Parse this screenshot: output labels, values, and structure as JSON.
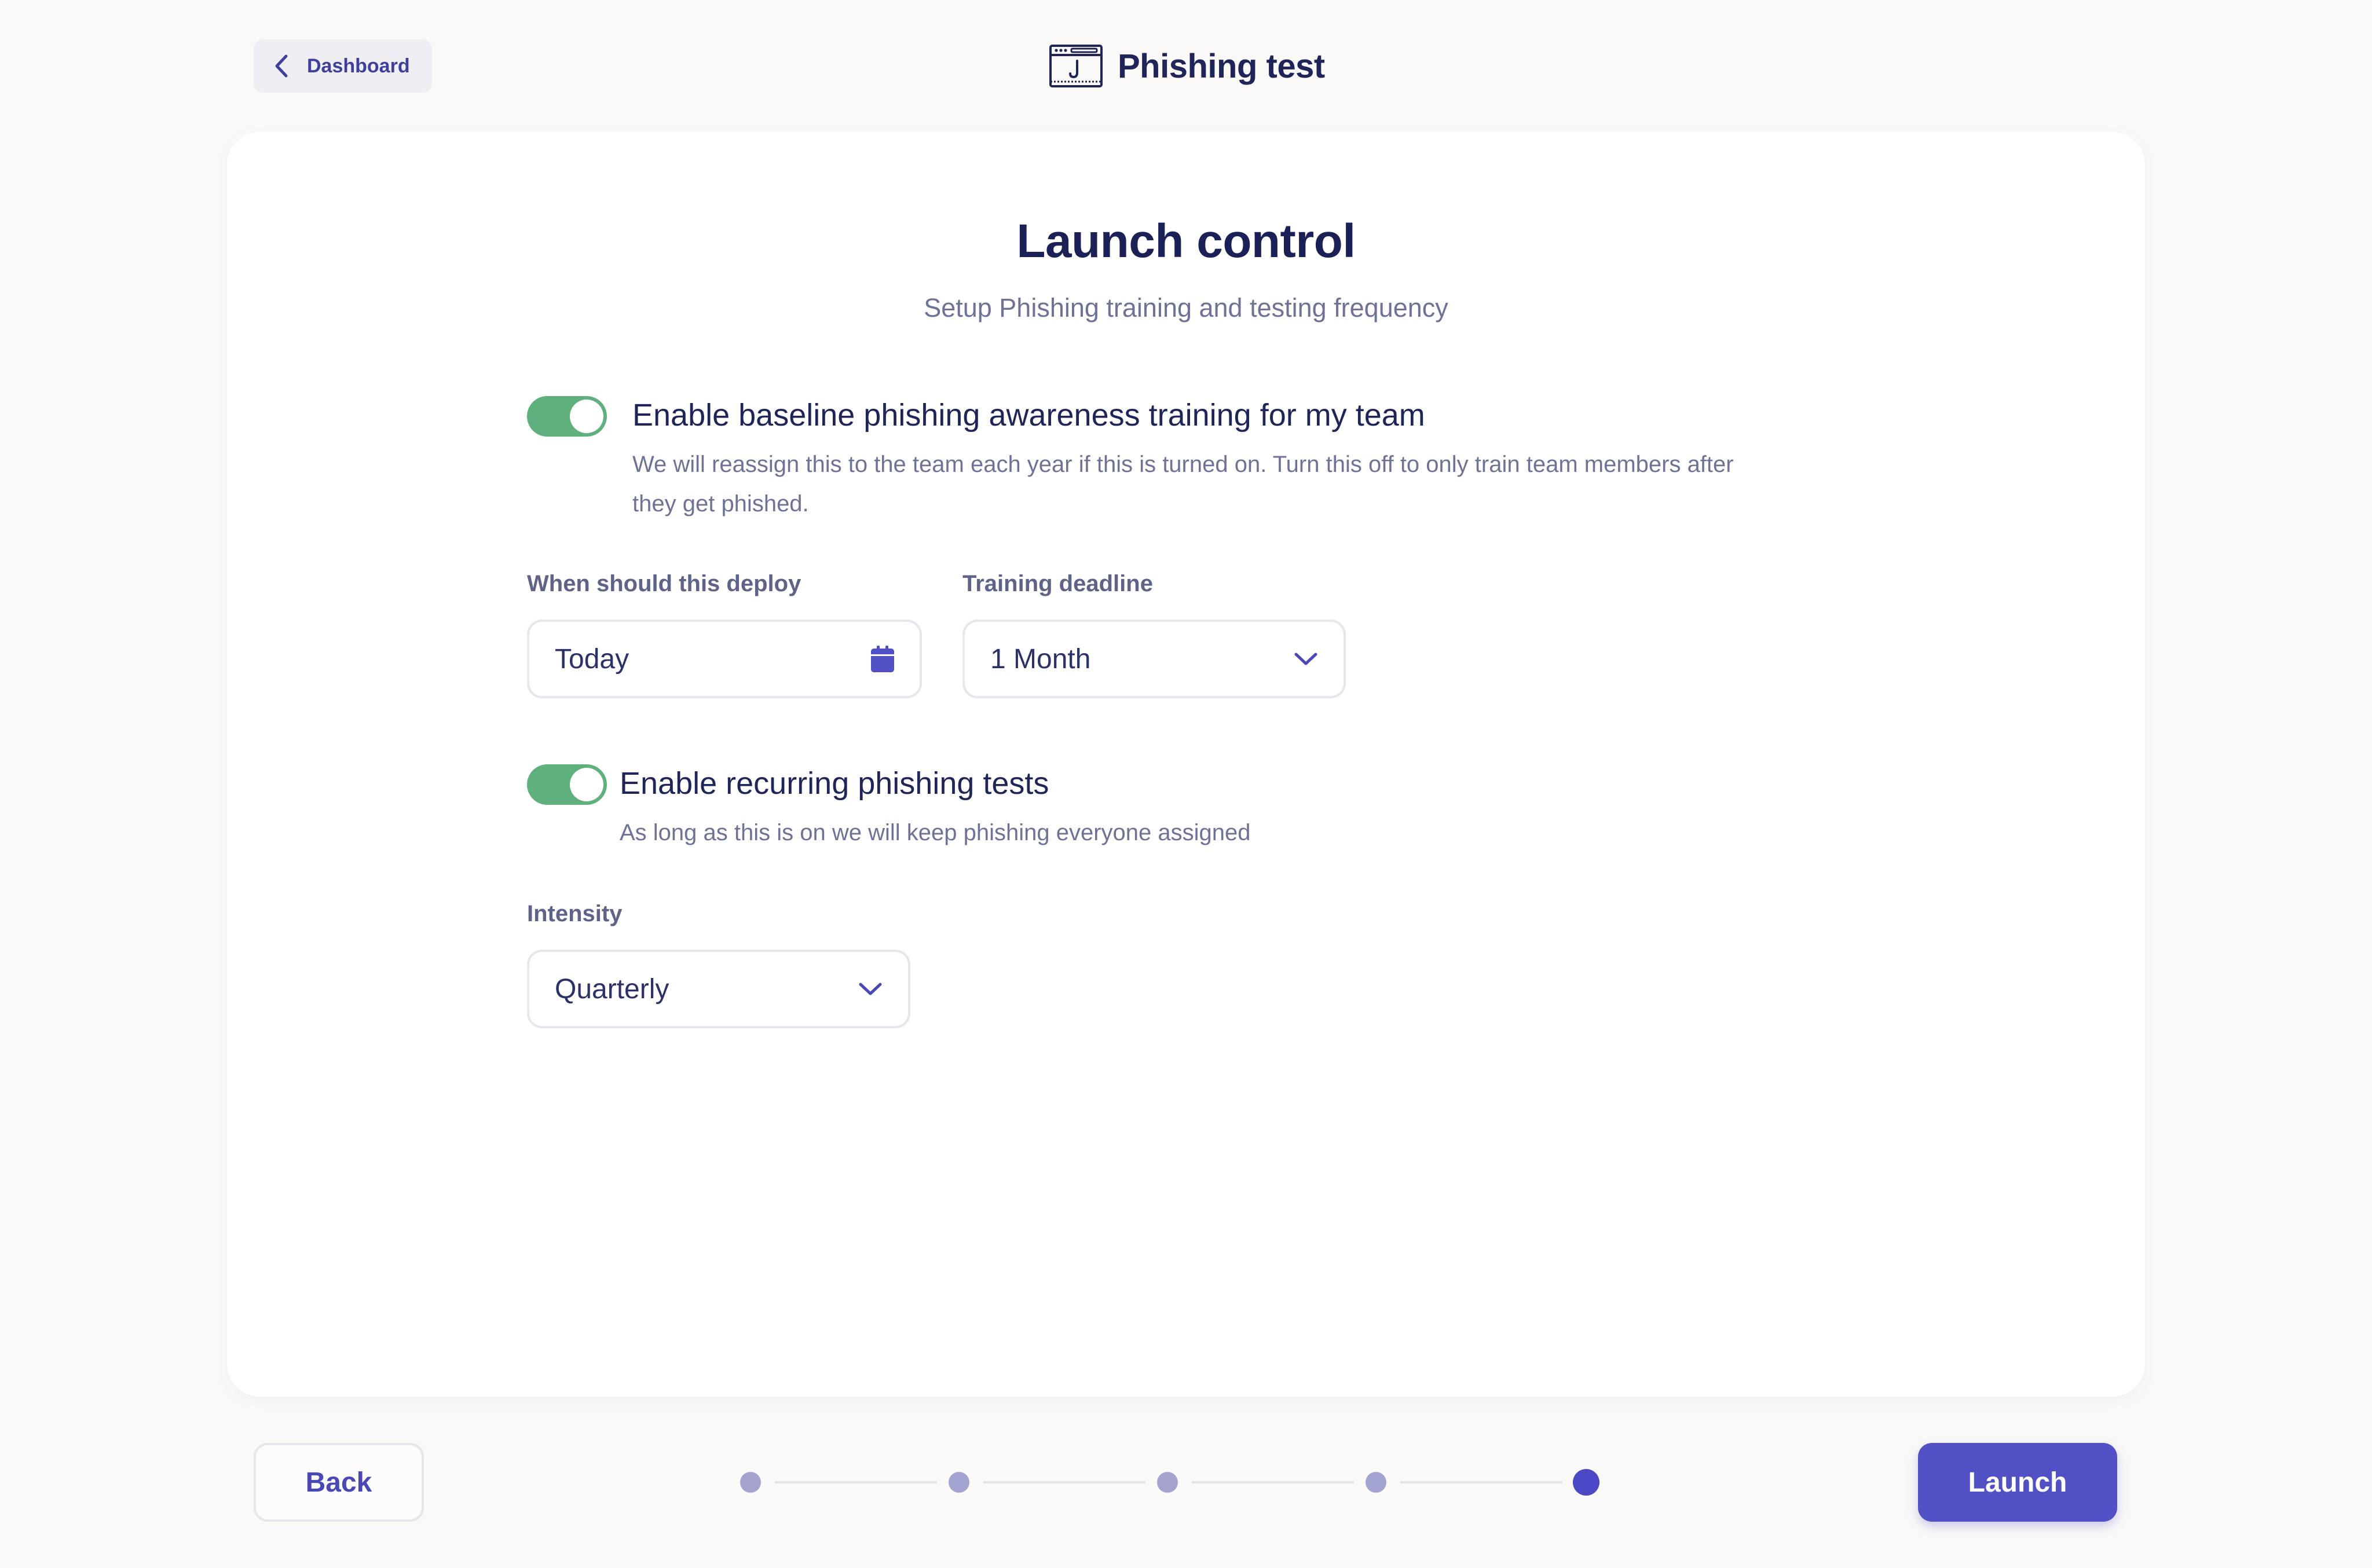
{
  "header": {
    "back_label": "Dashboard",
    "title": "Phishing test",
    "title_icon": "browser-hook-icon"
  },
  "card": {
    "heading": "Launch control",
    "subheading": "Setup Phishing training and testing frequency",
    "baseline": {
      "enabled": true,
      "title": "Enable baseline phishing awareness training for my team",
      "desc_line1": "We will reassign this to the team each year if this is turned on. Turn this off to only train team members after",
      "desc_line2": "they get phished."
    },
    "deploy": {
      "label": "When should this deploy",
      "value": "Today",
      "icon": "calendar-icon"
    },
    "deadline": {
      "label": "Training deadline",
      "value": "1 Month",
      "icon": "chevron-down-icon"
    },
    "recurring": {
      "enabled": true,
      "title": "Enable recurring phishing tests",
      "desc": "As long as this is on we will keep phishing everyone assigned"
    },
    "intensity": {
      "label": "Intensity",
      "value": "Quarterly",
      "icon": "chevron-down-icon"
    }
  },
  "footer": {
    "back_label": "Back",
    "launch_label": "Launch",
    "steps_total": 5,
    "current_step": 5
  },
  "colors": {
    "accent": "#5150c4",
    "toggle_on": "#5fb07c",
    "text_dark": "#1f2559",
    "text_muted": "#6e7296"
  }
}
